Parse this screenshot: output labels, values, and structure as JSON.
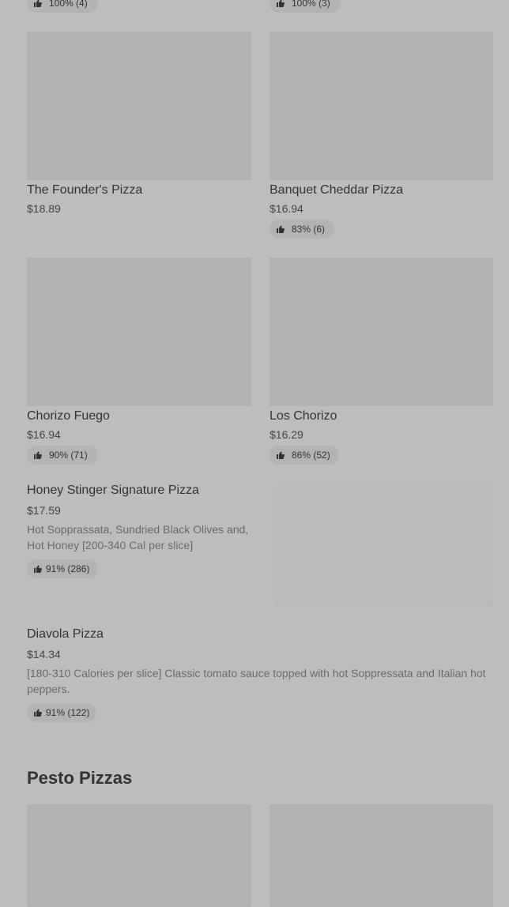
{
  "items": [
    {
      "rating": "100% (4)"
    },
    {
      "rating": "100% (3)"
    },
    {
      "name": "The Founder's Pizza",
      "price": "$18.89"
    },
    {
      "name": "Banquet Cheddar Pizza",
      "price": "$16.94",
      "rating": "83% (6)"
    },
    {
      "name": "Chorizo Fuego",
      "price": "$16.94",
      "rating": "90% (71)"
    },
    {
      "name": "Los Chorizo",
      "price": "$16.29",
      "rating": "86% (52)"
    },
    {
      "name": "Honey Stinger Signature Pizza",
      "price": "$17.59",
      "description": "Hot Sopprassata, Sundried Black Olives and, Hot Honey [200-340 Cal per slice]",
      "rating": "91% (286)"
    },
    {
      "name": "Diavola Pizza",
      "price": "$14.34",
      "description": "[180-310 Calories per slice] Classic tomato sauce topped with hot Soppressata and Italian hot peppers.",
      "rating": "91% (122)"
    }
  ],
  "sections": {
    "pesto_title": "Pesto Pizzas"
  },
  "icons": {
    "rating": "thumbs-up-icon"
  },
  "colors": {
    "background": "#bdbdbd",
    "image_placeholder": "#b1b1b1",
    "pill": "#b3b3b3"
  }
}
